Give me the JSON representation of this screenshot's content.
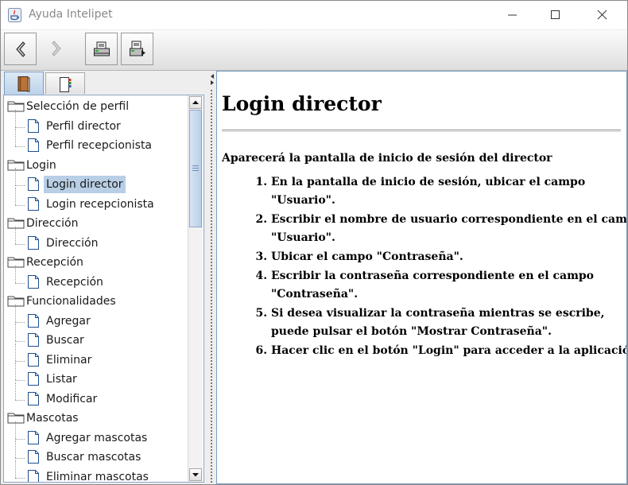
{
  "window": {
    "title": "Ayuda Intelipet"
  },
  "toolbar": {
    "buttons": [
      {
        "name": "back",
        "icon": "arrow-left-icon",
        "enabled": true
      },
      {
        "name": "forward",
        "icon": "arrow-right-icon",
        "enabled": false
      },
      {
        "name": "print",
        "icon": "printer-icon",
        "enabled": true
      },
      {
        "name": "page-setup",
        "icon": "page-setup-icon",
        "enabled": true
      }
    ]
  },
  "navigator": {
    "tabs": [
      {
        "name": "contents",
        "icon": "book-icon",
        "selected": true
      },
      {
        "name": "index",
        "icon": "index-icon",
        "selected": false
      }
    ],
    "tree": [
      {
        "label": "Selección de perfil",
        "type": "folder"
      },
      {
        "label": "Perfil director",
        "type": "page"
      },
      {
        "label": "Perfil recepcionista",
        "type": "page"
      },
      {
        "label": "Login",
        "type": "folder"
      },
      {
        "label": "Login director",
        "type": "page",
        "selected": true
      },
      {
        "label": "Login recepcionista",
        "type": "page"
      },
      {
        "label": "Dirección",
        "type": "folder"
      },
      {
        "label": "Dirección",
        "type": "page"
      },
      {
        "label": "Recepción",
        "type": "folder"
      },
      {
        "label": "Recepción",
        "type": "page"
      },
      {
        "label": "Funcionalidades",
        "type": "folder"
      },
      {
        "label": "Agregar",
        "type": "page"
      },
      {
        "label": "Buscar",
        "type": "page"
      },
      {
        "label": "Eliminar",
        "type": "page"
      },
      {
        "label": "Listar",
        "type": "page"
      },
      {
        "label": "Modificar",
        "type": "page"
      },
      {
        "label": "Mascotas",
        "type": "folder"
      },
      {
        "label": "Agregar mascotas",
        "type": "page"
      },
      {
        "label": "Buscar mascotas",
        "type": "page"
      },
      {
        "label": "Eliminar mascotas",
        "type": "page"
      }
    ]
  },
  "content": {
    "heading": "Login director",
    "intro": "Aparecerá la pantalla de inicio de sesión del director",
    "steps": [
      "En la pantalla de inicio de sesión, ubicar el campo \"Usuario\".",
      "Escribir el nombre de usuario correspondiente en el campo \"Usuario\".",
      "Ubicar el campo \"Contraseña\".",
      "Escribir la contraseña correspondiente en el campo \"Contraseña\".",
      "Si desea visualizar la contraseña mientras se escribe, puede pulsar el botón \"Mostrar Contraseña\".",
      "Hacer clic en el botón \"Login\" para acceder a la aplicación."
    ]
  },
  "colors": {
    "selection": "#b8cfe5",
    "accent": "#7a9cc4"
  }
}
